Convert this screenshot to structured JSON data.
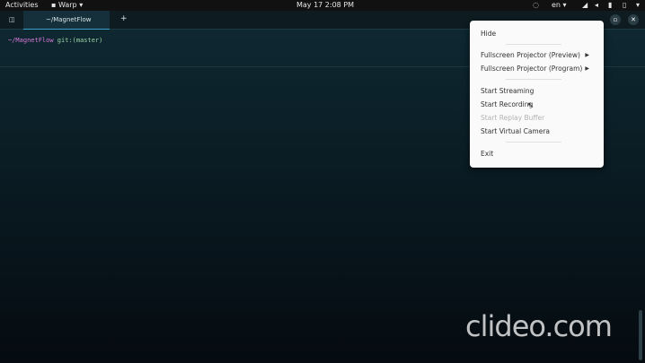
{
  "topbar": {
    "activities": "Activities",
    "app_name": "Warp",
    "clock": "May 17  2:08 PM",
    "language": "en"
  },
  "tabs": [
    {
      "label": "~/MagnetFlow"
    }
  ],
  "terminal": {
    "path": "~/MagnetFlow",
    "git": "git:(master)"
  },
  "menu": {
    "items": [
      {
        "label": "Hide"
      },
      {
        "label": "Fullscreen Projector (Preview)"
      },
      {
        "label": "Fullscreen Projector (Program)"
      },
      {
        "label": "Start Streaming"
      },
      {
        "label": "Start Recording"
      },
      {
        "label": "Start Replay Buffer"
      },
      {
        "label": "Start Virtual Camera"
      },
      {
        "label": "Exit"
      }
    ]
  },
  "watermark": "clideo.com"
}
